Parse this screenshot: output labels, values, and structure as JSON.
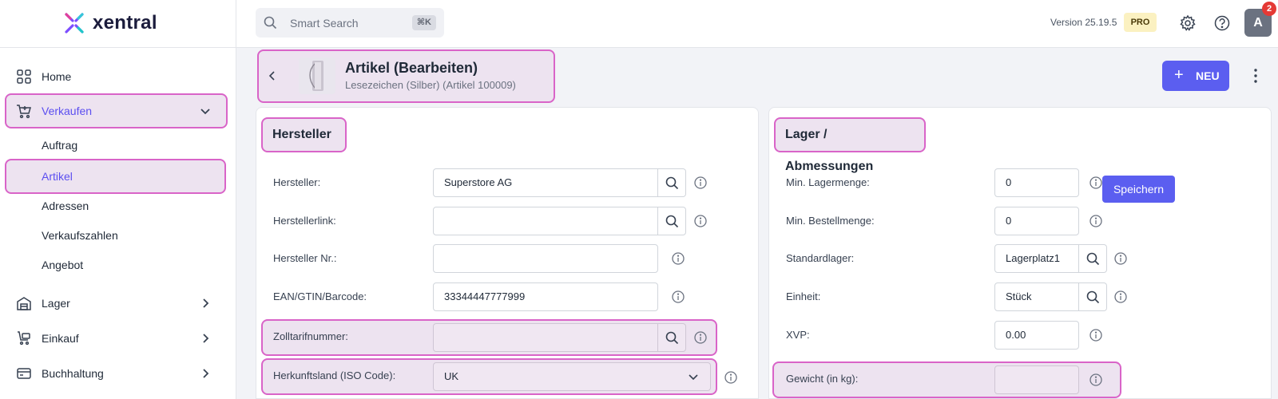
{
  "brand": {
    "name": "xentral"
  },
  "topbar": {
    "search_placeholder": "Smart Search",
    "search_shortcut": "⌘K",
    "version": "Version 25.19.5",
    "plan_badge": "PRO",
    "avatar_initial": "A",
    "notification_count": "2"
  },
  "sidebar": {
    "items": [
      {
        "label": "Home",
        "icon": "home-grid-icon"
      },
      {
        "label": "Verkaufen",
        "icon": "cart-icon",
        "expanded": true
      },
      {
        "label": "Lager",
        "icon": "warehouse-icon"
      },
      {
        "label": "Einkauf",
        "icon": "purchase-icon"
      },
      {
        "label": "Buchhaltung",
        "icon": "accounting-icon"
      }
    ],
    "sub_items": [
      {
        "label": "Auftrag"
      },
      {
        "label": "Artikel",
        "active": true
      },
      {
        "label": "Adressen"
      },
      {
        "label": "Verkaufszahlen"
      },
      {
        "label": "Angebot"
      }
    ]
  },
  "page": {
    "title": "Artikel (Bearbeiten)",
    "subtitle": "Lesezeichen (Silber) (Artikel 100009)",
    "new_button": "NEU",
    "save_button": "Speichern"
  },
  "hersteller": {
    "title": "Hersteller",
    "fields": [
      {
        "label": "Hersteller:",
        "value": "Superstore AG"
      },
      {
        "label": "Herstellerlink:",
        "value": ""
      },
      {
        "label": "Hersteller Nr.:",
        "value": ""
      },
      {
        "label": "EAN/GTIN/Barcode:",
        "value": "33344447777999"
      },
      {
        "label": "Zolltarifnummer:",
        "value": ""
      },
      {
        "label": "Herkunftsland (ISO Code):",
        "value": "UK"
      }
    ]
  },
  "lager": {
    "title": "Lager / Abmessungen",
    "fields": [
      {
        "label": "Min. Lagermenge:",
        "value": "0"
      },
      {
        "label": "Min. Bestellmenge:",
        "value": "0"
      },
      {
        "label": "Standardlager:",
        "value": "Lagerplatz1"
      },
      {
        "label": "Einheit:",
        "value": "Stück"
      },
      {
        "label": "XVP:",
        "value": "0.00"
      },
      {
        "label": "Gewicht (in kg):",
        "value": ""
      }
    ]
  },
  "colors": {
    "accent": "#5b5ef0",
    "highlight_bg": "#ede3f0",
    "highlight_border": "#d964c8",
    "pro_badge": "#fbf1c1",
    "notification": "#e53935"
  }
}
